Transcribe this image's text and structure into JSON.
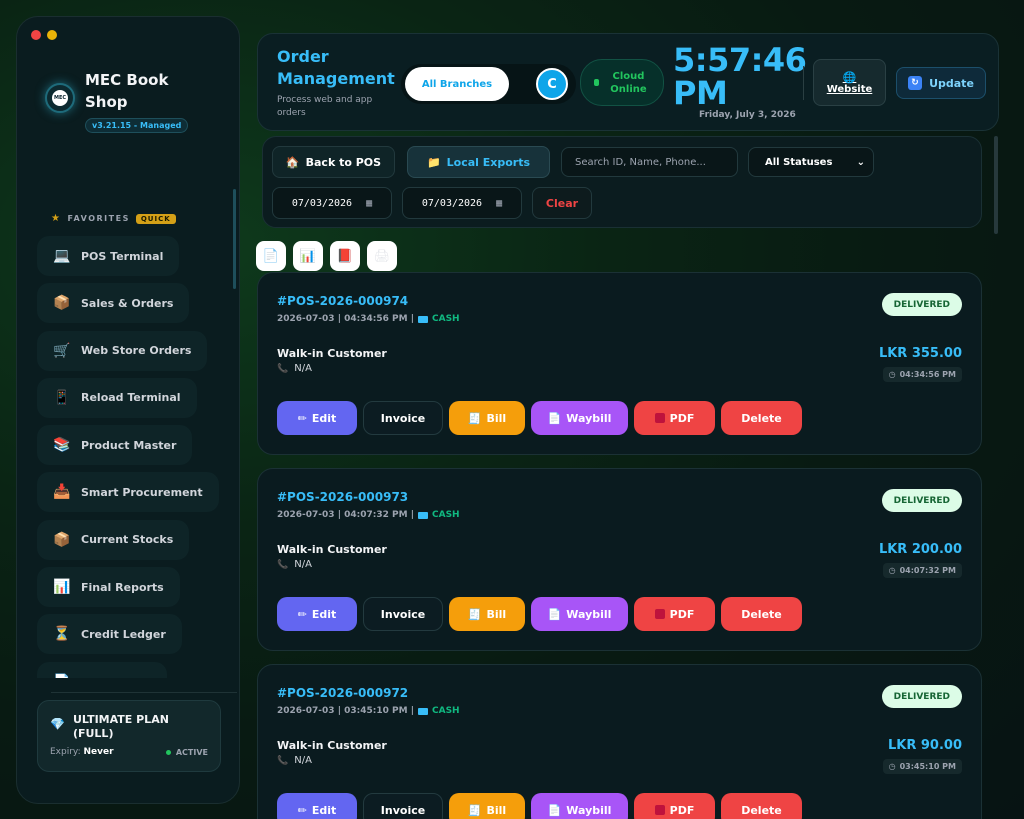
{
  "sidebar": {
    "brand_name": "MEC Book Shop",
    "logo_text": "MEC",
    "version": "v3.21.15 - Managed",
    "favorites_label": "FAVORITES",
    "quick_badge": "QUICK",
    "items": [
      {
        "label": "POS Terminal",
        "icon": "laptop-icon",
        "glyph": "💻"
      },
      {
        "label": "Sales & Orders",
        "icon": "package-icon",
        "glyph": "📦"
      },
      {
        "label": "Web Store Orders",
        "icon": "cart-icon",
        "glyph": "🛒"
      },
      {
        "label": "Reload Terminal",
        "icon": "mobile-icon",
        "glyph": "📱"
      },
      {
        "label": "Product Master",
        "icon": "books-icon",
        "glyph": "📚"
      },
      {
        "label": "Smart Procurement",
        "icon": "inbox-icon",
        "glyph": "📥"
      },
      {
        "label": "Current Stocks",
        "icon": "box-icon",
        "glyph": "📦"
      },
      {
        "label": "Final Reports",
        "icon": "chart-icon",
        "glyph": "📊"
      },
      {
        "label": "Credit Ledger",
        "icon": "hourglass-icon",
        "glyph": "⏳"
      },
      {
        "label": "",
        "icon": "document-icon",
        "glyph": "📄"
      }
    ],
    "plan": {
      "title": "ULTIMATE PLAN (FULL)",
      "expiry_label": "Expiry:",
      "expiry_value": "Never",
      "status": "ACTIVE"
    }
  },
  "header": {
    "title": "Order Management",
    "subtitle": "Process web and app orders",
    "branch_button": "All Branches",
    "avatar_letter": "C",
    "cloud_status": "Cloud Online",
    "clock": "5:57:46 PM",
    "date": "Friday, July 3, 2026",
    "website_label": "Website",
    "update_label": "Update"
  },
  "filters": {
    "back_pos": "Back to POS",
    "local_exports": "Local Exports",
    "search_placeholder": "Search ID, Name, Phone...",
    "status_select": "All Statuses",
    "date_from": "07/03/2026",
    "date_to": "07/03/2026",
    "clear": "Clear"
  },
  "export_icons": [
    "document-icon",
    "chart-icon",
    "book-icon",
    "printer-icon"
  ],
  "action_labels": {
    "edit": "Edit",
    "invoice": "Invoice",
    "bill": "Bill",
    "waybill": "Waybill",
    "pdf": "PDF",
    "delete": "Delete"
  },
  "orders": [
    {
      "id": "#POS-2026-000974",
      "datetime": "2026-07-03 | 04:34:56 PM |",
      "payment": "CASH",
      "status": "DELIVERED",
      "customer": "Walk-in Customer",
      "phone": "N/A",
      "amount": "LKR 355.00",
      "time": "04:34:56 PM"
    },
    {
      "id": "#POS-2026-000973",
      "datetime": "2026-07-03 | 04:07:32 PM |",
      "payment": "CASH",
      "status": "DELIVERED",
      "customer": "Walk-in Customer",
      "phone": "N/A",
      "amount": "LKR 200.00",
      "time": "04:07:32 PM"
    },
    {
      "id": "#POS-2026-000972",
      "datetime": "2026-07-03 | 03:45:10 PM |",
      "payment": "CASH",
      "status": "DELIVERED",
      "customer": "Walk-in Customer",
      "phone": "N/A",
      "amount": "LKR 90.00",
      "time": "03:45:10 PM"
    }
  ],
  "colors": {
    "accent": "#38bdf8",
    "success": "#22c55e",
    "edit": "#6366f1",
    "bill": "#f59e0b",
    "waybill": "#a855f7",
    "danger": "#ef4444"
  }
}
